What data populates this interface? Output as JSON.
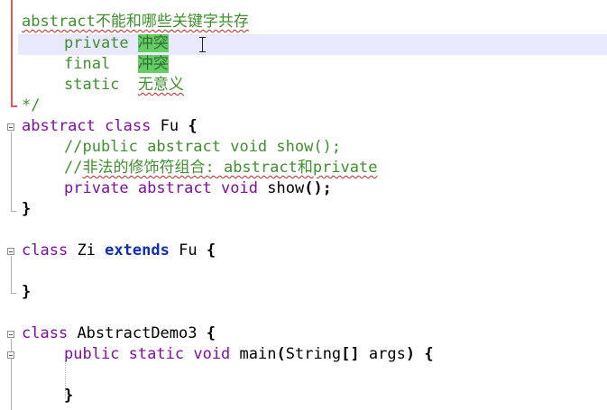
{
  "code": {
    "l1": "abstract不能和哪些关键字共存",
    "l2_kw": "private",
    "l2_note": "冲突",
    "l3_kw": "final",
    "l3_note": "冲突",
    "l4_kw": "static",
    "l4_note": "无意义",
    "l5": "*/",
    "l6_a": "abstract",
    "l6_b": "class",
    "l6_c": "Fu",
    "l6_d": "{",
    "l7": "//public abstract void show();",
    "l8_a": "//",
    "l8_b": "非法的修饰符组合: abstract和private",
    "l9_a": "private",
    "l9_b": "abstract",
    "l9_c": "void",
    "l9_d": "show",
    "l9_e": "();",
    "l10": "}",
    "l11_a": "class",
    "l11_b": "Zi",
    "l11_c": "extends",
    "l11_d": "Fu",
    "l11_e": "{",
    "l12": "}",
    "l13_a": "class",
    "l13_b": "AbstractDemo3",
    "l13_c": "{",
    "l14_a": "public",
    "l14_b": "static",
    "l14_c": "void",
    "l14_d": "main",
    "l14_e": "(",
    "l14_f": "String",
    "l14_g": "[]",
    "l14_h": "args",
    "l14_i": ")",
    "l14_j": "{",
    "l15": "}"
  },
  "colors": {
    "comment": "#3f8f2f",
    "keyword": "#7f0f9f",
    "keyword_bold": "#1030b0",
    "selection": "#66cc66",
    "current_line": "#e8e8ff"
  }
}
